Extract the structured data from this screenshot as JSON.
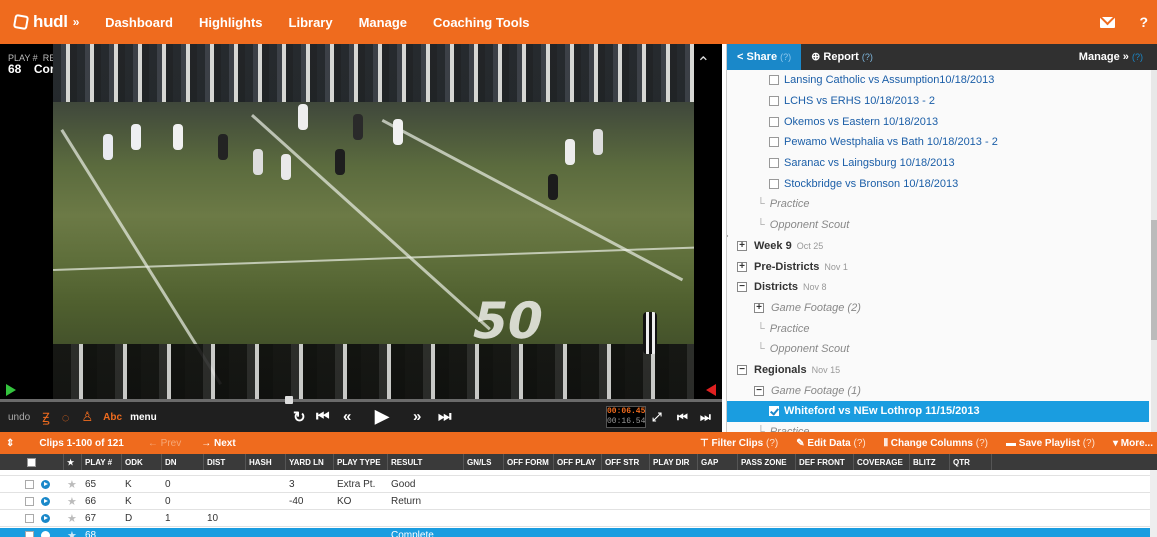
{
  "brand": {
    "name": "hudl",
    "accent": "#ef6b1e",
    "selected_blue": "#1a9de0"
  },
  "nav": {
    "items": [
      "Dashboard",
      "Highlights",
      "Library",
      "Manage",
      "Coaching Tools"
    ],
    "mail_icon": "mail-icon",
    "help_label": "?"
  },
  "player": {
    "play_label": "PLAY #",
    "result_label": "RESULT",
    "play_number": "68",
    "result": "Complete",
    "current_time": "00:06.45",
    "total_time": "00:16.54",
    "scrub_progress": 0.39
  },
  "controls": {
    "undo": "undo",
    "abc": "Abc",
    "menu": "menu"
  },
  "panel": {
    "share_label": "Share",
    "report_label": "Report",
    "q": "(?)",
    "manage_label": "Manage »",
    "tree": [
      {
        "type": "game",
        "label": "Lansing Catholic vs Assumption10/18/2013"
      },
      {
        "type": "game",
        "label": "LCHS vs ERHS 10/18/2013 - 2"
      },
      {
        "type": "game",
        "label": "Okemos vs Eastern 10/18/2013"
      },
      {
        "type": "game",
        "label": "Pewamo Westphalia vs Bath 10/18/2013 - 2"
      },
      {
        "type": "game",
        "label": "Saranac vs Laingsburg 10/18/2013"
      },
      {
        "type": "game",
        "label": "Stockbridge vs Bronson 10/18/2013"
      },
      {
        "type": "sub",
        "label": "Practice"
      },
      {
        "type": "sub",
        "label": "Opponent Scout"
      },
      {
        "type": "week",
        "label": "Week 9",
        "date": "Oct 25",
        "sign": "+"
      },
      {
        "type": "week",
        "label": "Pre-Districts",
        "date": "Nov 1",
        "sign": "+"
      },
      {
        "type": "week",
        "label": "Districts",
        "date": "Nov 8",
        "sign": "−"
      },
      {
        "type": "subfolder",
        "label": "Game Footage (2)",
        "sign": "+"
      },
      {
        "type": "sub",
        "label": "Practice"
      },
      {
        "type": "sub",
        "label": "Opponent Scout"
      },
      {
        "type": "week",
        "label": "Regionals",
        "date": "Nov 15",
        "sign": "−"
      },
      {
        "type": "subfolder",
        "label": "Game Footage (1)",
        "sign": "−"
      },
      {
        "type": "selected",
        "label": "Whiteford vs NEw Lothrop 11/15/2013"
      },
      {
        "type": "sub",
        "label": "Practice"
      }
    ]
  },
  "clips": {
    "count_label": "Clips 1-100 of 121",
    "prev_label": "← Prev",
    "next_label": "→ Next",
    "filter_label": "Filter Clips",
    "edit_label": "Edit Data",
    "columns_label": "Change Columns",
    "playlist_label": "Save Playlist",
    "more_label": "More...",
    "q": "(?)"
  },
  "grid": {
    "headers": [
      "★",
      "PLAY #",
      "ODK",
      "DN",
      "DIST",
      "HASH",
      "YARD LN",
      "PLAY TYPE",
      "RESULT",
      "GN/LS",
      "OFF FORM",
      "OFF PLAY",
      "OFF STR",
      "PLAY DIR",
      "GAP",
      "PASS ZONE",
      "DEF FRONT",
      "COVERAGE",
      "BLITZ",
      "QTR"
    ],
    "rows": [
      {
        "play": "65",
        "odk": "K",
        "dn": "0",
        "dist": "",
        "hash": "",
        "yard": "3",
        "type": "Extra Pt.",
        "result": "Good"
      },
      {
        "play": "66",
        "odk": "K",
        "dn": "0",
        "dist": "",
        "hash": "",
        "yard": "-40",
        "type": "KO",
        "result": "Return"
      },
      {
        "play": "67",
        "odk": "D",
        "dn": "1",
        "dist": "10",
        "hash": "",
        "yard": "",
        "type": "",
        "result": ""
      },
      {
        "play": "68",
        "odk": "",
        "dn": "",
        "dist": "",
        "hash": "",
        "yard": "",
        "type": "",
        "result": "Complete",
        "selected": true
      }
    ]
  }
}
